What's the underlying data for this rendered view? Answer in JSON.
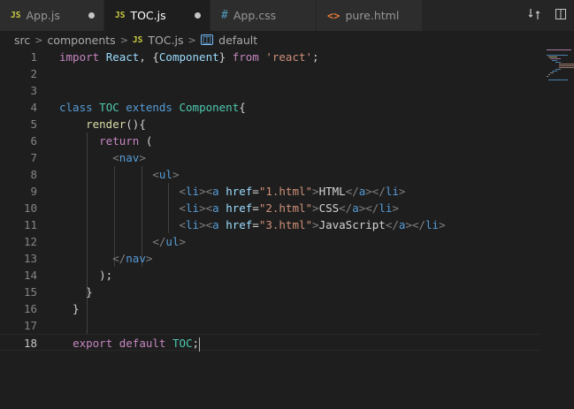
{
  "tabs": [
    {
      "icon": "JS",
      "label": "App.js",
      "dirty": true
    },
    {
      "icon": "JS",
      "label": "TOC.js",
      "dirty": true,
      "active": true
    },
    {
      "icon": "#",
      "label": "App.css"
    },
    {
      "icon": "<>",
      "label": "pure.html"
    }
  ],
  "breadcrumb": {
    "parts": [
      "src",
      "components",
      "TOC.js",
      "default"
    ],
    "file_icon": "JS"
  },
  "editor": {
    "current_line": 18,
    "lines": [
      {
        "n": "1",
        "tokens": [
          [
            "kc",
            "import"
          ],
          [
            "pu",
            " "
          ],
          [
            "id",
            "React"
          ],
          [
            "pu",
            ", {"
          ],
          [
            "id",
            "Component"
          ],
          [
            "pu",
            "} "
          ],
          [
            "kc",
            "from"
          ],
          [
            "pu",
            " "
          ],
          [
            "str",
            "'react'"
          ],
          [
            "pu",
            ";"
          ]
        ]
      },
      {
        "n": "2",
        "tokens": []
      },
      {
        "n": "3",
        "tokens": []
      },
      {
        "n": "4",
        "tokens": [
          [
            "kw",
            "class"
          ],
          [
            "pu",
            " "
          ],
          [
            "cls",
            "TOC"
          ],
          [
            "pu",
            " "
          ],
          [
            "kw",
            "extends"
          ],
          [
            "pu",
            " "
          ],
          [
            "cls",
            "Component"
          ],
          [
            "pu",
            "{"
          ]
        ]
      },
      {
        "n": "5",
        "tokens": [
          [
            "pu",
            "    "
          ],
          [
            "fn",
            "render"
          ],
          [
            "pu",
            "(){"
          ]
        ]
      },
      {
        "n": "6",
        "tokens": [
          [
            "pu",
            "      "
          ],
          [
            "kc",
            "return"
          ],
          [
            "pu",
            " ("
          ]
        ]
      },
      {
        "n": "7",
        "tokens": [
          [
            "pu",
            "        "
          ],
          [
            "br",
            "<"
          ],
          [
            "tag",
            "nav"
          ],
          [
            "br",
            ">"
          ]
        ]
      },
      {
        "n": "8",
        "tokens": [
          [
            "pu",
            "              "
          ],
          [
            "br",
            "<"
          ],
          [
            "tag",
            "ul"
          ],
          [
            "br",
            ">"
          ]
        ]
      },
      {
        "n": "9",
        "tokens": [
          [
            "pu",
            "                  "
          ],
          [
            "br",
            "<"
          ],
          [
            "tag",
            "li"
          ],
          [
            "br",
            "><"
          ],
          [
            "tag",
            "a"
          ],
          [
            "pu",
            " "
          ],
          [
            "at",
            "href"
          ],
          [
            "pu",
            "="
          ],
          [
            "str",
            "\"1.html\""
          ],
          [
            "br",
            ">"
          ],
          [
            "pu",
            "HTML"
          ],
          [
            "br",
            "</"
          ],
          [
            "tag",
            "a"
          ],
          [
            "br",
            "></"
          ],
          [
            "tag",
            "li"
          ],
          [
            "br",
            ">"
          ]
        ]
      },
      {
        "n": "10",
        "tokens": [
          [
            "pu",
            "                  "
          ],
          [
            "br",
            "<"
          ],
          [
            "tag",
            "li"
          ],
          [
            "br",
            "><"
          ],
          [
            "tag",
            "a"
          ],
          [
            "pu",
            " "
          ],
          [
            "at",
            "href"
          ],
          [
            "pu",
            "="
          ],
          [
            "str",
            "\"2.html\""
          ],
          [
            "br",
            ">"
          ],
          [
            "pu",
            "CSS"
          ],
          [
            "br",
            "</"
          ],
          [
            "tag",
            "a"
          ],
          [
            "br",
            "></"
          ],
          [
            "tag",
            "li"
          ],
          [
            "br",
            ">"
          ]
        ]
      },
      {
        "n": "11",
        "tokens": [
          [
            "pu",
            "                  "
          ],
          [
            "br",
            "<"
          ],
          [
            "tag",
            "li"
          ],
          [
            "br",
            "><"
          ],
          [
            "tag",
            "a"
          ],
          [
            "pu",
            " "
          ],
          [
            "at",
            "href"
          ],
          [
            "pu",
            "="
          ],
          [
            "str",
            "\"3.html\""
          ],
          [
            "br",
            ">"
          ],
          [
            "pu",
            "JavaScript"
          ],
          [
            "br",
            "</"
          ],
          [
            "tag",
            "a"
          ],
          [
            "br",
            "></"
          ],
          [
            "tag",
            "li"
          ],
          [
            "br",
            ">"
          ]
        ]
      },
      {
        "n": "12",
        "tokens": [
          [
            "pu",
            "              "
          ],
          [
            "br",
            "</"
          ],
          [
            "tag",
            "ul"
          ],
          [
            "br",
            ">"
          ]
        ]
      },
      {
        "n": "13",
        "tokens": [
          [
            "pu",
            "        "
          ],
          [
            "br",
            "</"
          ],
          [
            "tag",
            "nav"
          ],
          [
            "br",
            ">"
          ]
        ]
      },
      {
        "n": "14",
        "tokens": [
          [
            "pu",
            "      );"
          ]
        ]
      },
      {
        "n": "15",
        "tokens": [
          [
            "pu",
            "    }"
          ]
        ]
      },
      {
        "n": "16",
        "tokens": [
          [
            "pu",
            "  }"
          ]
        ]
      },
      {
        "n": "17",
        "tokens": []
      },
      {
        "n": "18",
        "tokens": [
          [
            "pu",
            "  "
          ],
          [
            "kc",
            "export"
          ],
          [
            "pu",
            " "
          ],
          [
            "kc",
            "default"
          ],
          [
            "pu",
            " "
          ],
          [
            "cls",
            "TOC"
          ],
          [
            "pu",
            ";"
          ]
        ]
      }
    ]
  },
  "colors": {
    "background": "#1e1e1e",
    "tabbar": "#252526",
    "keyword": "#569cd6",
    "control": "#c586c0",
    "string": "#ce9178",
    "class": "#4ec9b0",
    "js_icon": "#cbcb41"
  }
}
